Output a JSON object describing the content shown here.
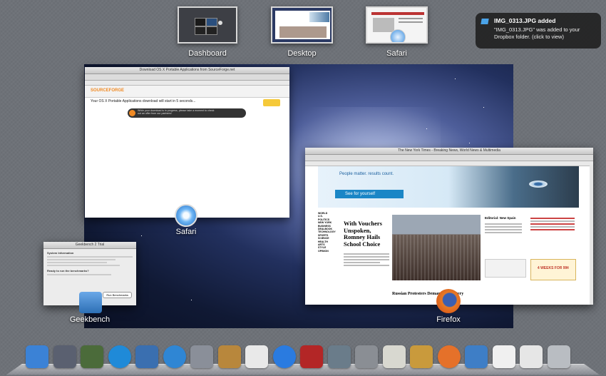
{
  "spaces": {
    "dashboard_label": "Dashboard",
    "desktop_label": "Desktop",
    "safari_label": "Safari"
  },
  "notification": {
    "title": "IMG_0313.JPG added",
    "body": "\"IMG_0313.JPG\" was added to your Dropbox folder. (click to view)"
  },
  "windows": {
    "safari": {
      "label": "Safari",
      "title": "Download OS X Portable Applications from SourceForge.net",
      "logo": "SOURCEFORGE",
      "headline": "Your OS X Portable Applications download will start in 5 seconds...",
      "banner_text": "While your download is in progress, please take a moment to check out an offer from our partners!"
    },
    "firefox": {
      "label": "Firefox",
      "title": "The New York Times - Breaking News, World News & Multimedia",
      "ad_text": "People matter. results count.",
      "ad_button": "See for yourself",
      "headline": "With Vouchers Unspoken, Romney Hails School Choice",
      "bottom_headline": "Russian Protesters Demand the Outery",
      "opinion_title": "Editorial: New Spain",
      "promo": "4 WEEKS FOR 99¢",
      "nav_items": [
        "WORLD",
        "U.S.",
        "POLITICS",
        "NEW YORK",
        "BUSINESS",
        "DEALBOOK",
        "TECHNOLOGY",
        "SPORTS",
        "SCIENCE",
        "HEALTH",
        "ARTS",
        "STYLE",
        "OPINION"
      ]
    },
    "geekbench": {
      "label": "Geekbench",
      "title": "Geekbench 2 Trial",
      "section1": "System Information",
      "section2": "Ready to run the benchmarks?",
      "button": "Run Benchmarks"
    }
  },
  "dock": {
    "items": [
      {
        "name": "finder-icon",
        "color": "#3b82d6"
      },
      {
        "name": "launchpad-icon",
        "color": "#5a6070"
      },
      {
        "name": "mission-control-icon",
        "color": "#4b6b3a"
      },
      {
        "name": "app-store-icon",
        "color": "#1f8ad8"
      },
      {
        "name": "preview-icon",
        "color": "#3a6fb0"
      },
      {
        "name": "safari-icon",
        "color": "#2f86d4"
      },
      {
        "name": "facetime-icon",
        "color": "#8a8f99"
      },
      {
        "name": "address-book-icon",
        "color": "#b8873c"
      },
      {
        "name": "ical-icon",
        "color": "#e9e9e9"
      },
      {
        "name": "itunes-icon",
        "color": "#2a7be0"
      },
      {
        "name": "photo-booth-icon",
        "color": "#b32626"
      },
      {
        "name": "iphoto-icon",
        "color": "#6a7c8a"
      },
      {
        "name": "system-preferences-icon",
        "color": "#8a8e94"
      },
      {
        "name": "textedit-icon",
        "color": "#d8d8d0"
      },
      {
        "name": "pencil-icon",
        "color": "#c99a3c"
      },
      {
        "name": "firefox-icon",
        "color": "#e5712a"
      },
      {
        "name": "geekbench-icon",
        "color": "#3e7ec6"
      },
      {
        "name": "document-icon",
        "color": "#f0f0f0"
      },
      {
        "name": "downloads-stack-icon",
        "color": "#e6e6e6"
      },
      {
        "name": "trash-icon",
        "color": "#b9bdc2"
      }
    ]
  }
}
